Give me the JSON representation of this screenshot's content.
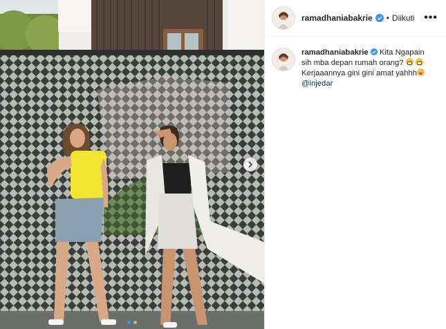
{
  "post": {
    "username": "ramadhaniabakrie",
    "separator": "•",
    "follow_status": "Diikuti",
    "more_label": "•••",
    "caption": {
      "username": "ramadhaniabakrie",
      "line1": " Kita Ngapain sih mba depan rumah orang? ",
      "line2": "Kerjaaannya gini gini amat yahhh",
      "mention": "@injedar"
    },
    "carousel": {
      "slide_count": 2,
      "current_slide": 1
    },
    "colors": {
      "verified": "#3897f0",
      "mention": "#00376b",
      "active_dot": "#3b95f0"
    }
  }
}
